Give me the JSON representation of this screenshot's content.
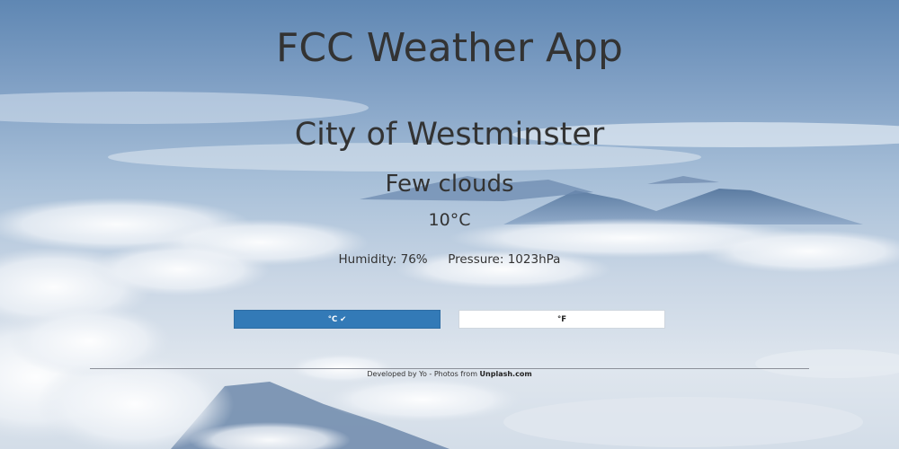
{
  "app": {
    "title": "FCC Weather App"
  },
  "weather": {
    "city": "City of Westminster",
    "condition": "Few clouds",
    "temperature": "10°C",
    "humidity_label": "Humidity:",
    "humidity_value": "76%",
    "pressure_label": "Pressure:",
    "pressure_value": "1023hPa"
  },
  "units": {
    "celsius_label": "°C",
    "celsius_check": "✔",
    "fahrenheit_label": "°F",
    "selected": "celsius"
  },
  "footer": {
    "text": "Developed by Yo - Photos from",
    "link_label": "Unplash.com"
  },
  "colors": {
    "accent": "#337ab7",
    "text": "#333333"
  }
}
